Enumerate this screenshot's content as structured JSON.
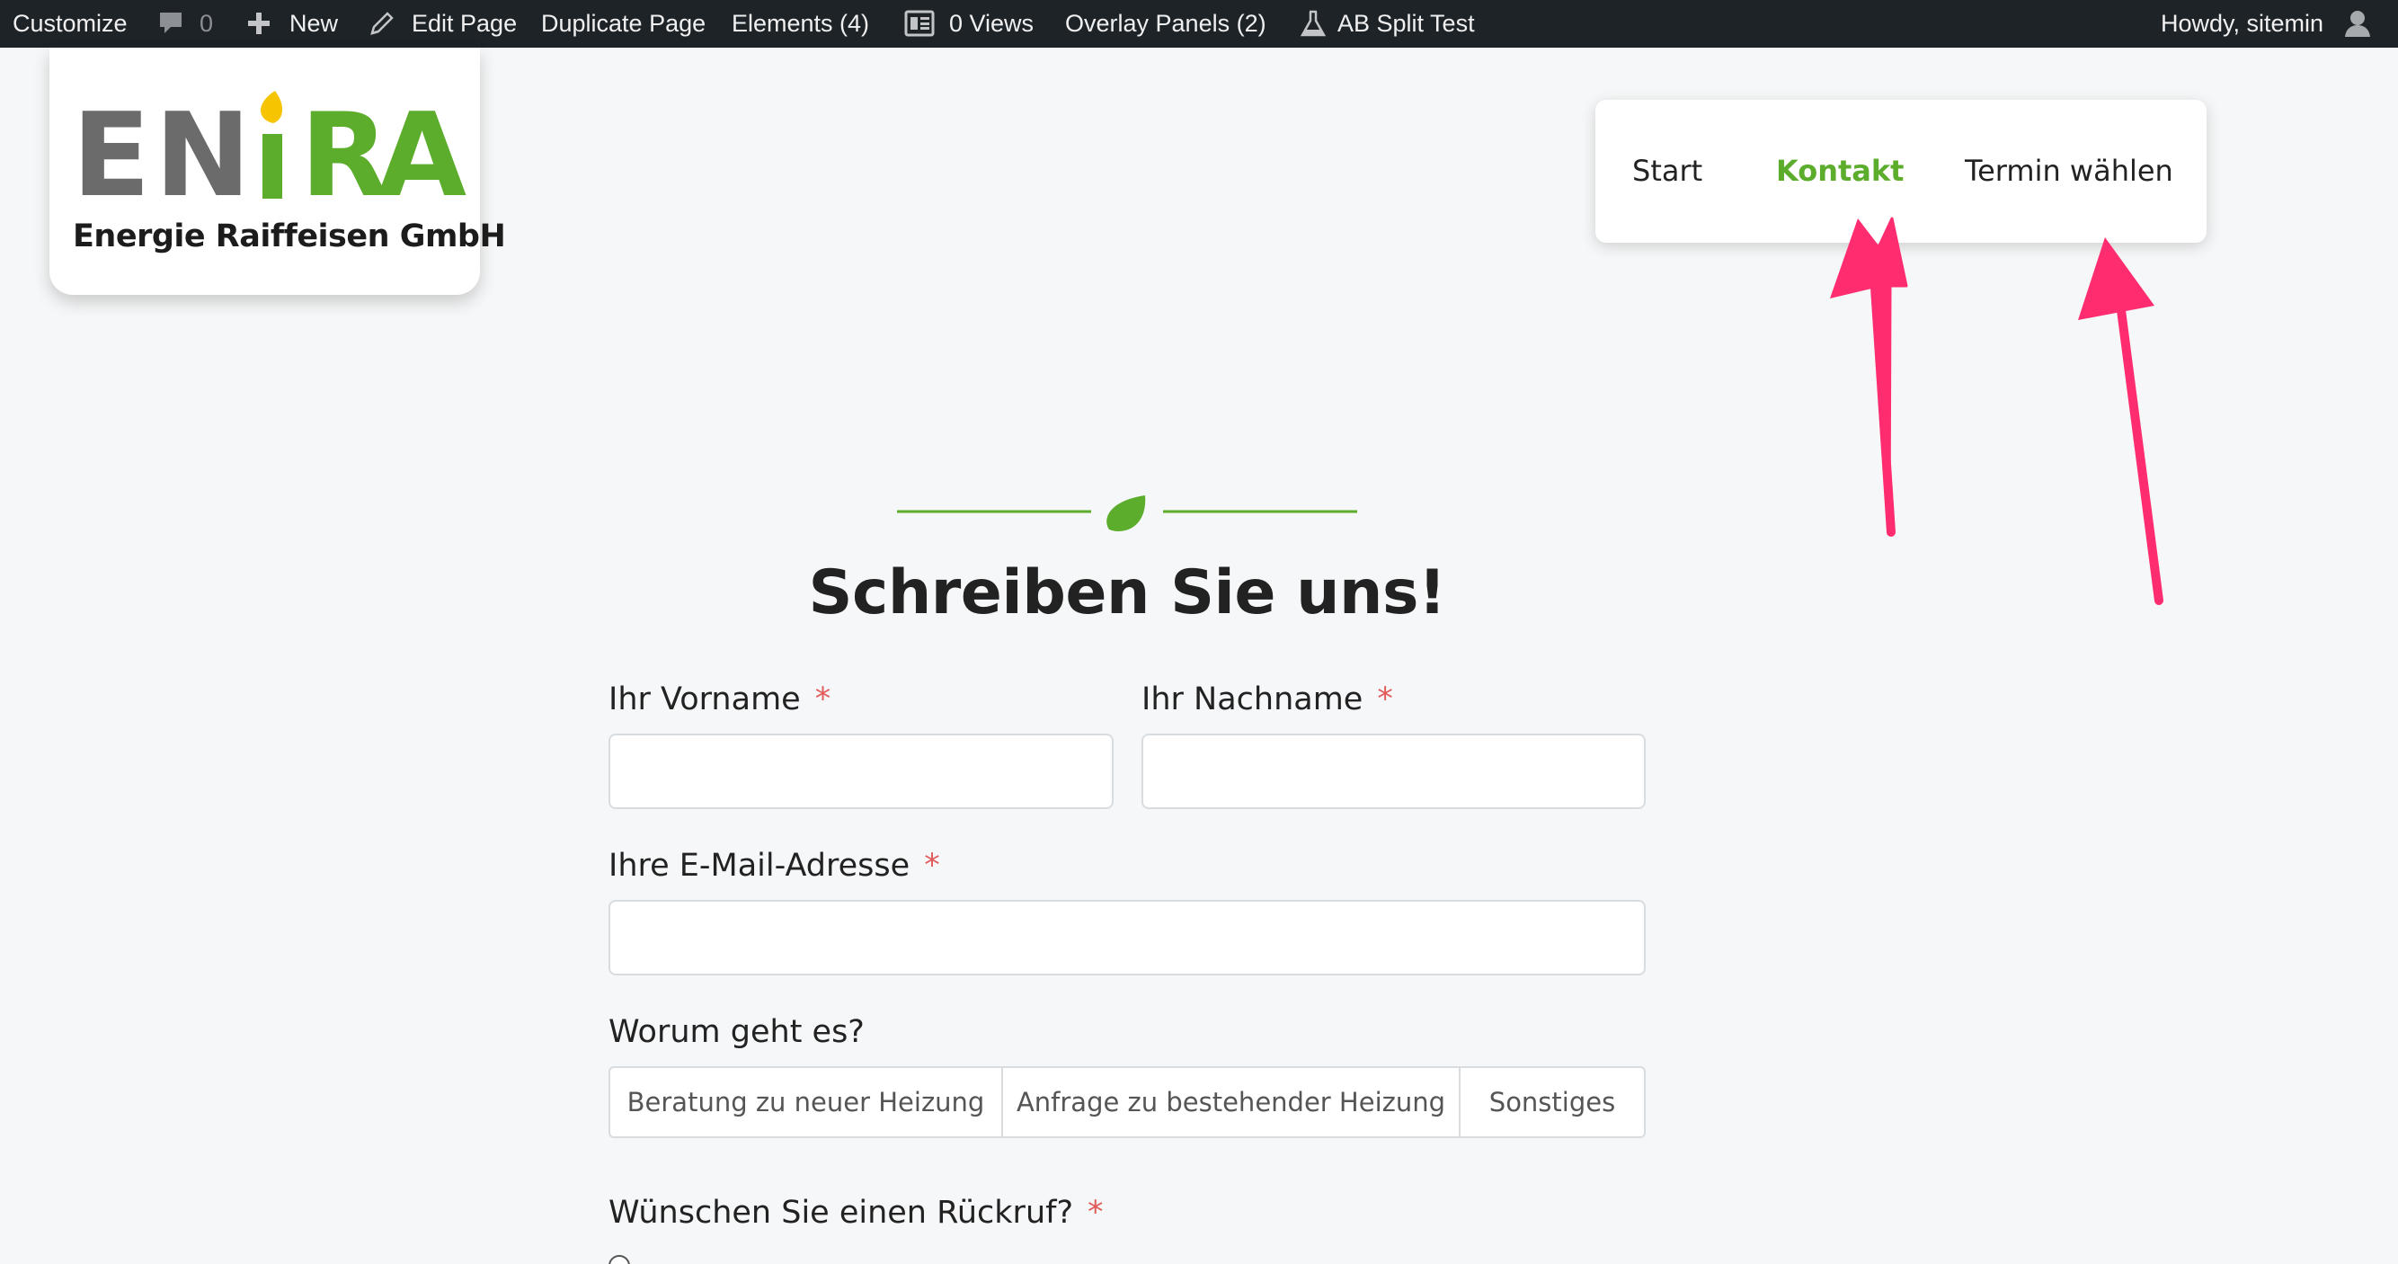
{
  "admin_bar": {
    "customize": "Customize",
    "comments_count": "0",
    "new": "New",
    "edit_page": "Edit Page",
    "duplicate_page": "Duplicate Page",
    "elements": "Elements (4)",
    "views": "0 Views",
    "overlay_panels": "Overlay Panels (2)",
    "ab_split_test": "AB Split Test",
    "howdy": "Howdy, sitemin"
  },
  "logo": {
    "wordmark_letters": [
      "E",
      "N",
      "i",
      "R",
      "A"
    ],
    "tagline": "Energie Raiffeisen GmbH",
    "colors": {
      "gray": "#6b6b6b",
      "yellow": "#f6c400",
      "green": "#5cad2c"
    }
  },
  "nav": {
    "items": [
      {
        "label": "Start",
        "active": false
      },
      {
        "label": "Kontakt",
        "active": true
      },
      {
        "label": "Termin wählen",
        "active": false
      }
    ]
  },
  "annotation": {
    "arrow_color": "#ff2d6f"
  },
  "theme": {
    "accent": "#5cad2c",
    "required": "#e15b5b"
  },
  "form": {
    "heading": "Schreiben Sie uns!",
    "firstname_label": "Ihr Vorname",
    "lastname_label": "Ihr Nachname",
    "email_label": "Ihre E-Mail-Adresse",
    "required_mark": "*",
    "topic_label": "Worum geht es?",
    "topic_options": [
      "Beratung zu neuer Heizung",
      "Anfrage zu bestehender Heizung",
      "Sonstiges"
    ],
    "callback_label": "Wünschen Sie einen Rückruf?",
    "firstname_value": "",
    "lastname_value": "",
    "email_value": ""
  }
}
